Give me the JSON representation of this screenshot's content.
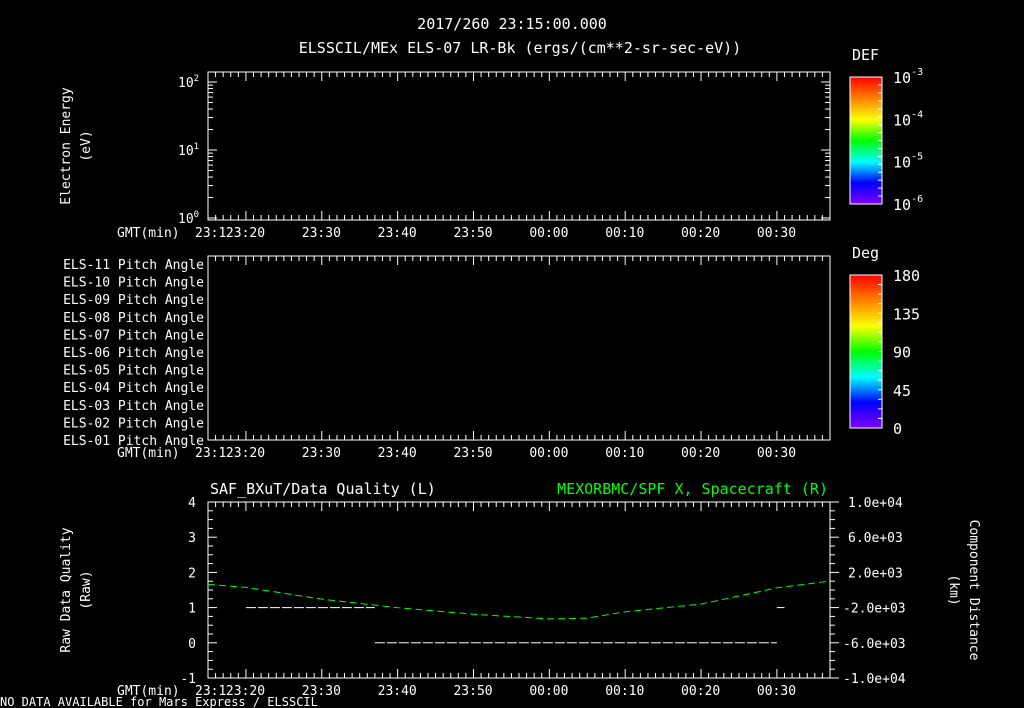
{
  "header": {
    "title": "2017/260 23:15:00.000",
    "subtitle": "ELSSCIL/MEx ELS-07 LR-Bk  (ergs/(cm**2-sr-sec-eV))"
  },
  "footer": {
    "status": "NO DATA AVAILABLE for Mars Express / ELSSCIL"
  },
  "colors": {
    "background": "#000000",
    "axes": "#ffffff",
    "quality_series": "#ffffff",
    "position_series": "#00ff00"
  },
  "chart_data": [
    {
      "type": "heatmap",
      "ylabel": "Electron Energy (eV)",
      "ylabel_lines": [
        "Electron Energy",
        "(eV)"
      ],
      "yscale": "log",
      "ytick_labels": [
        {
          "base": "10",
          "exp": "0",
          "value": 1
        },
        {
          "base": "10",
          "exp": "1",
          "value": 10
        },
        {
          "base": "10",
          "exp": "2",
          "value": 100
        }
      ],
      "ylim": [
        1,
        140
      ],
      "xlabel": "GMT(min)",
      "xtick_labels": [
        "23:1",
        "23:20",
        "23:30",
        "23:40",
        "23:50",
        "00:00",
        "00:10",
        "00:20",
        "00:30"
      ],
      "xlim_minutes_after_2300": [
        15,
        97
      ],
      "colorbar": {
        "title": "DEF",
        "scale": "log",
        "labels": [
          {
            "base": "10",
            "exp": "-3"
          },
          {
            "base": "10",
            "exp": "-4"
          },
          {
            "base": "10",
            "exp": "-5"
          },
          {
            "base": "10",
            "exp": "-6"
          }
        ],
        "range": [
          1e-06,
          0.001
        ],
        "colormap": "rainbow"
      },
      "values": []
    },
    {
      "type": "heatmap",
      "row_labels": [
        "ELS-11 Pitch Angle",
        "ELS-10 Pitch Angle",
        "ELS-09 Pitch Angle",
        "ELS-08 Pitch Angle",
        "ELS-07 Pitch Angle",
        "ELS-06 Pitch Angle",
        "ELS-05 Pitch Angle",
        "ELS-04 Pitch Angle",
        "ELS-03 Pitch Angle",
        "ELS-02 Pitch Angle",
        "ELS-01 Pitch Angle"
      ],
      "xlabel": "GMT(min)",
      "xtick_labels": [
        "23:1",
        "23:20",
        "23:30",
        "23:40",
        "23:50",
        "00:00",
        "00:10",
        "00:20",
        "00:30"
      ],
      "colorbar": {
        "title": "Deg",
        "labels": [
          "180",
          "135",
          "90",
          "45",
          "0"
        ],
        "range": [
          0,
          180
        ],
        "colormap": "rainbow"
      },
      "values": []
    },
    {
      "type": "line",
      "title_left": "SAF_BXuT/Data Quality (L)",
      "title_right": "MEXORBMC/SPF X, Spacecraft (R)",
      "ylabel_left_lines": [
        "Raw Data Quality",
        "(Raw)"
      ],
      "ylabel_right_lines": [
        "Component Distance",
        "(km)"
      ],
      "ylim_left": [
        -1,
        4
      ],
      "ytick_labels_left": [
        "4",
        "3",
        "2",
        "1",
        "0",
        "-1"
      ],
      "ylim_right": [
        -10000,
        10000
      ],
      "ytick_labels_right": [
        "1.0e+04",
        "6.0e+03",
        "2.0e+03",
        "-2.0e+03",
        "-6.0e+03",
        "-1.0e+04"
      ],
      "xlabel": "GMT(min)",
      "xtick_labels": [
        "23:1",
        "23:20",
        "23:30",
        "23:40",
        "23:50",
        "00:00",
        "00:10",
        "00:20",
        "00:30"
      ],
      "series": [
        {
          "axis": "left",
          "style": "dashed",
          "segments": [
            {
              "x": [
                "23:20",
                "23:37"
              ],
              "y": [
                1,
                1
              ]
            },
            {
              "x": [
                "23:37",
                "00:30"
              ],
              "y": [
                0,
                0
              ]
            },
            {
              "x": [
                "00:30",
                "00:31"
              ],
              "y": [
                1,
                1
              ]
            }
          ]
        },
        {
          "axis": "right",
          "style": "dashed",
          "x": [
            "23:15",
            "23:20",
            "23:30",
            "23:40",
            "23:50",
            "00:00",
            "00:05",
            "00:10",
            "00:20",
            "00:30",
            "00:37"
          ],
          "y": [
            640,
            300,
            -1040,
            -2010,
            -2760,
            -3280,
            -3200,
            -2480,
            -1600,
            240,
            1020
          ]
        }
      ]
    }
  ]
}
